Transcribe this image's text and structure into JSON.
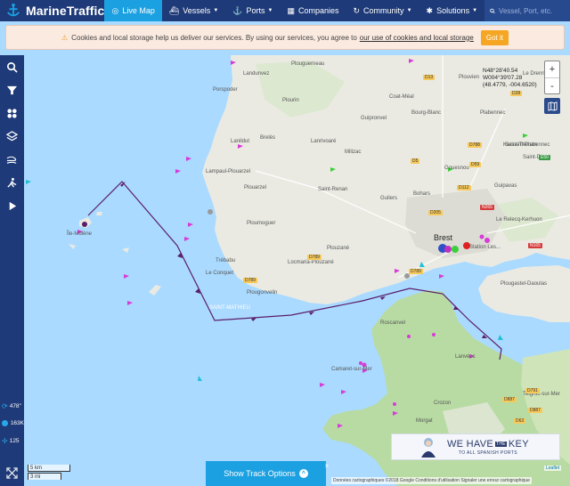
{
  "app": {
    "name": "MarineTraffic"
  },
  "nav": [
    {
      "label": "Live Map",
      "active": true
    },
    {
      "label": "Vessels"
    },
    {
      "label": "Ports"
    },
    {
      "label": "Companies"
    },
    {
      "label": "Community"
    },
    {
      "label": "Solutions"
    }
  ],
  "search": {
    "placeholder": "Vessel, Port, etc."
  },
  "cookie": {
    "text": "Cookies and local storage help us deliver our services. By using our services, you agree to",
    "link": "our use of cookies and local storage",
    "button": "Got it"
  },
  "sidebar": {
    "buttons": [
      "search-icon",
      "filter-icon",
      "fleet-icon",
      "layers-icon",
      "weather-icon",
      "route-icon",
      "play-icon"
    ],
    "stats": [
      {
        "icon": "refresh-icon",
        "value": "478\""
      },
      {
        "icon": "vessel-icon",
        "value": "163K"
      },
      {
        "icon": "port-icon",
        "value": "125"
      }
    ]
  },
  "map": {
    "coords": [
      "N48°28'40.54",
      "W004°39'07.28",
      "(48.4779, -004.6520)"
    ],
    "zoom_in": "+",
    "zoom_out": "-",
    "scale_km": "5 km",
    "scale_mi": "3 mi",
    "labels": {
      "brest": "Brest",
      "plouguerneau": "Plouguerneau",
      "landunvez": "Landunvez",
      "porspoder": "Porspoder",
      "plourin": "Plourin",
      "lanildut": "Lanildut",
      "brelès": "Brelès",
      "lanrivoare": "Lanrivoaré",
      "coat_meal": "Coat-Méal",
      "plouvien": "Plouvien",
      "gruprovel": "Guipronvel",
      "bourg_blanc": "Bourg-Blanc",
      "plabennec": "Plabennec",
      "saint_pabu": "Saint-Pabu",
      "milizac": "Milizac",
      "lampaul_plouarzel": "Lampaul-Plouarzel",
      "plouarzel": "Plouarzel",
      "saint_renan": "Saint-Renan",
      "gouesnou": "Gouesnou",
      "bohars": "Bohars",
      "guilers": "Guilers",
      "guipavas": "Guipavas",
      "saint_thonan": "Saint-Thonan",
      "le_relecq": "Le Relecq-Kerhuon",
      "ile_molene": "Île-Molène",
      "plougonvelin": "Plougonvelin",
      "le_conquet": "Le Conquet",
      "trebabu": "Trébabu",
      "ploumoguer": "Ploumoguer",
      "plouzane": "Plouzané",
      "locmaria": "Locmaria-Plouzané",
      "saint_mathieu": "SAINT-MATHIEU",
      "plougastel": "Plougastel-Daoulas",
      "roscanvel": "Roscanvel",
      "lanveoc": "Lanvéoc",
      "camaret": "Camaret-sur-Mer",
      "crozon": "Crozon",
      "morgat": "Morgat",
      "telgruc": "Telgruc-sur-Mer",
      "le_drennec": "Le Drennec",
      "saint_divy": "Saint-Divy",
      "kersaint": "Kersaint-Plabennec",
      "station": "Station Les..."
    },
    "roads": [
      "D13",
      "D28",
      "D788",
      "D59",
      "D5",
      "D112",
      "D205",
      "N265",
      "D789",
      "D789",
      "D789",
      "E50",
      "N165",
      "D791",
      "D887",
      "D887",
      "D63"
    ]
  },
  "track": {
    "label": "Show Track Options",
    "close": "×"
  },
  "attribution": "Données cartographiques ©2018 Google   Conditions d'utilisation   Signaler une erreur cartographique",
  "leaflet": "Leaflet",
  "ad": {
    "head_left": "WE HAVE",
    "the": "THE",
    "head_right": "KEY",
    "sub": "TO ALL SPANISH PORTS"
  },
  "colors": {
    "topbar": "#1e3a78",
    "accent": "#1ba0e1",
    "sea": "#aadaff",
    "land": "#eaeae3",
    "green": "#b8dba3",
    "track": "#5a1e6b"
  }
}
